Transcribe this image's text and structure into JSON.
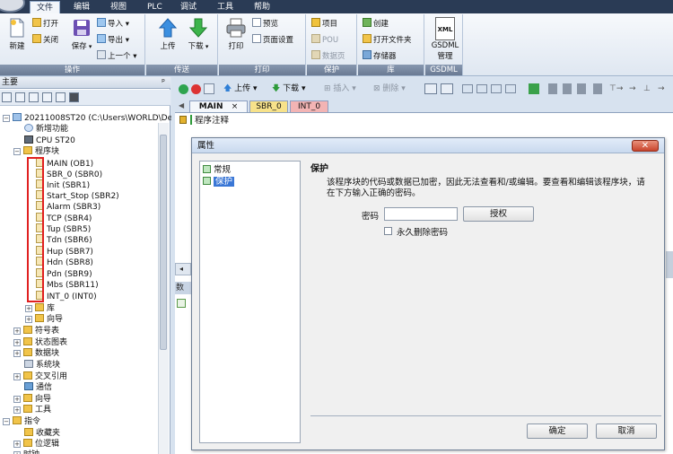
{
  "menubar": {
    "items": [
      "文件",
      "编辑",
      "视图",
      "PLC",
      "调试",
      "工具",
      "帮助"
    ]
  },
  "ribbon": {
    "groups": {
      "ops": {
        "title": "操作",
        "new": "新建",
        "open": "打开",
        "close": "关闭",
        "save": "保存",
        "import": "导入",
        "export": "导出",
        "prev": "上一个"
      },
      "transfer": {
        "title": "传送",
        "upload": "上传",
        "download": "下载"
      },
      "print": {
        "title": "打印",
        "print": "打印",
        "preview": "预览",
        "page_setup": "页面设置"
      },
      "protect": {
        "title": "保护",
        "project": "项目",
        "pou": "POU",
        "data_page": "数据页"
      },
      "lib": {
        "title": "库",
        "create": "创建",
        "open_folder": "打开文件夹",
        "memory": "存储器"
      },
      "gsdml": {
        "title": "GSDML",
        "xml": "XML",
        "manage_line1": "GSDML",
        "manage_line2": "管理"
      }
    }
  },
  "left_panel": {
    "title": "主要",
    "pin": "ᵖ",
    "project": "20211008ST20 (C:\\Users\\WORLD\\De",
    "new_feature": "新增功能",
    "cpu": "CPU ST20",
    "program_block": "程序块",
    "pous": [
      "MAIN (OB1)",
      "SBR_0 (SBR0)",
      "Init (SBR1)",
      "Start_Stop (SBR2)",
      "Alarm (SBR3)",
      "TCP (SBR4)",
      "Tup (SBR5)",
      "Tdn (SBR6)",
      "Hup (SBR7)",
      "Hdn (SBR8)",
      "Pdn (SBR9)",
      "Mbs (SBR11)",
      "INT_0 (INT0)"
    ],
    "lib": "库",
    "wizard_sub": "向导",
    "tree": [
      "符号表",
      "状态图表",
      "数据块",
      "系统块",
      "交叉引用",
      "通信",
      "向导",
      "工具"
    ],
    "instructions": "指令",
    "favorites": "收藏夹",
    "bit_logic": "位逻辑",
    "clock": "时钟"
  },
  "editor": {
    "upload": "上传",
    "download": "下载",
    "insert": "插入",
    "delete": "删除",
    "tabs": [
      "MAIN",
      "SBR_0",
      "INT_0"
    ],
    "tab_close": "×",
    "program_comment": "程序注释",
    "bottom_tab": "数据"
  },
  "dialog": {
    "title": "属性",
    "close": "✕",
    "nav": [
      "常规",
      "保护"
    ],
    "section": "保护",
    "description": "该程序块的代码或数据已加密，因此无法查看和/或编辑。要查看和编辑该程序块，请在下方输入正确的密码。",
    "password_label": "密码",
    "password_value": "",
    "authorize": "授权",
    "permanent_delete": "永久删除密码",
    "ok": "确定",
    "cancel": "取消"
  },
  "colors": {
    "menubar_bg": "#2a3b55",
    "tab_active": "#f4f7fb",
    "tab_sbr": "#f7e28a",
    "tab_int": "#f3b4b4",
    "highlight_box": "#e02020",
    "selection": "#3a77d6"
  }
}
